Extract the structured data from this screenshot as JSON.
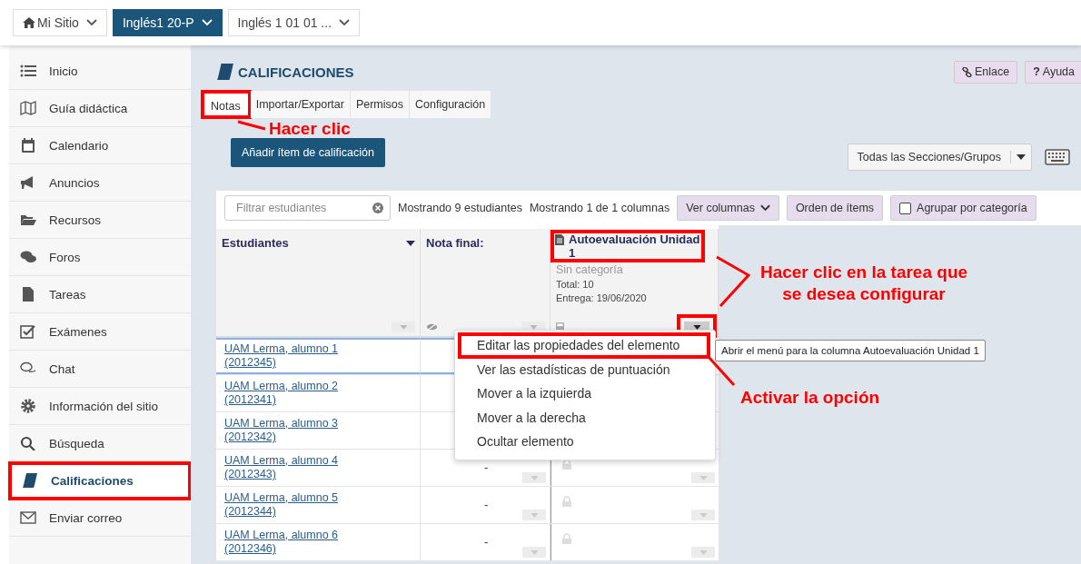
{
  "top_bar": {
    "sites": [
      {
        "kind": "home",
        "label": "Mi Sitio",
        "selected": false
      },
      {
        "kind": "site",
        "label": "Inglés1 20-P",
        "selected": true
      },
      {
        "kind": "site",
        "label": "Inglés 1 01 01 ...",
        "selected": false
      }
    ]
  },
  "sidebar": {
    "items": [
      {
        "label": "Inicio",
        "selected": false,
        "highlighted": false
      },
      {
        "label": "Guía didáctica",
        "selected": false,
        "highlighted": false
      },
      {
        "label": "Calendario",
        "selected": false,
        "highlighted": false
      },
      {
        "label": "Anuncios",
        "selected": false,
        "highlighted": false
      },
      {
        "label": "Recursos",
        "selected": false,
        "highlighted": false
      },
      {
        "label": "Foros",
        "selected": false,
        "highlighted": false
      },
      {
        "label": "Tareas",
        "selected": false,
        "highlighted": false
      },
      {
        "label": "Exámenes",
        "selected": false,
        "highlighted": false
      },
      {
        "label": "Chat",
        "selected": false,
        "highlighted": false
      },
      {
        "label": "Información del sitio",
        "selected": false,
        "highlighted": false
      },
      {
        "label": "Búsqueda",
        "selected": false,
        "highlighted": false
      },
      {
        "label": "Calificaciones",
        "selected": true,
        "highlighted": true
      },
      {
        "label": "Enviar correo",
        "selected": false,
        "highlighted": false
      }
    ]
  },
  "page": {
    "title": "CALIFICACIONES",
    "header_buttons": [
      {
        "kind": "link",
        "label": "Enlace"
      },
      {
        "kind": "help",
        "glyph": "?",
        "label": "Ayuda"
      }
    ],
    "tabs": [
      {
        "label": "Notas",
        "selected": true,
        "highlighted": true
      },
      {
        "label": "Importar/Exportar",
        "selected": false,
        "highlighted": false
      },
      {
        "label": "Permisos",
        "selected": false,
        "highlighted": false
      },
      {
        "label": "Configuración",
        "selected": false,
        "highlighted": false
      }
    ],
    "add_button": "Añadir ítem de calificación",
    "section_select": "Todas las Secciones/Grupos"
  },
  "gradebook": {
    "filter": {
      "placeholder": "Filtrar estudiantes"
    },
    "student_count": "Mostrando 9 estudiantes",
    "column_count": "Mostrando 1 de 1 columnas",
    "toolbar_buttons": [
      {
        "kind": "dropdown",
        "label": "Ver columnas"
      },
      {
        "kind": "plain",
        "label": "Orden de ítems"
      },
      {
        "kind": "checkbox",
        "label": "Agrupar por categoría",
        "checked": false
      }
    ],
    "columns": [
      {
        "kind": "students",
        "title": "Estudiantes"
      },
      {
        "kind": "final",
        "title": "Nota final:"
      },
      {
        "kind": "assignment",
        "title": "Autoevaluación Unidad 1",
        "highlighted": true,
        "category": "Sin categoría",
        "total": "Total: 10",
        "due": "Entrega: 19/06/2020",
        "menu_highlighted": true
      }
    ],
    "rows": [
      {
        "student": "UAM Lerma, alumno 1 (2012345)",
        "selected": true
      },
      {
        "student": "UAM Lerma, alumno 2 (2012341)",
        "selected": false
      },
      {
        "student": "UAM Lerma, alumno 3 (2012342)",
        "selected": false
      },
      {
        "student": "UAM Lerma, alumno 4 (2012343)",
        "selected": false,
        "grade": "-",
        "locked": true
      },
      {
        "student": "UAM Lerma, alumno 5 (2012344)",
        "selected": false,
        "grade": "-",
        "locked": true
      },
      {
        "student": "UAM Lerma, alumno 6 (2012346)",
        "selected": false,
        "grade": "-",
        "locked": true
      }
    ],
    "column_menu": {
      "items": [
        {
          "label": "Editar las propiedades del elemento",
          "highlighted": true
        },
        {
          "label": "Ver las estadísticas de puntuación",
          "highlighted": false
        },
        {
          "label": "Mover a la izquierda",
          "highlighted": false
        },
        {
          "label": "Mover a la derecha",
          "highlighted": false
        },
        {
          "label": "Ocultar elemento",
          "highlighted": false
        }
      ]
    },
    "tooltip": "Abrir el menú para la columna Autoevaluación Unidad 1"
  },
  "annotations": [
    "Hacer clic",
    "Hacer clic en la tarea que se desea configurar",
    "Activar la opción"
  ]
}
